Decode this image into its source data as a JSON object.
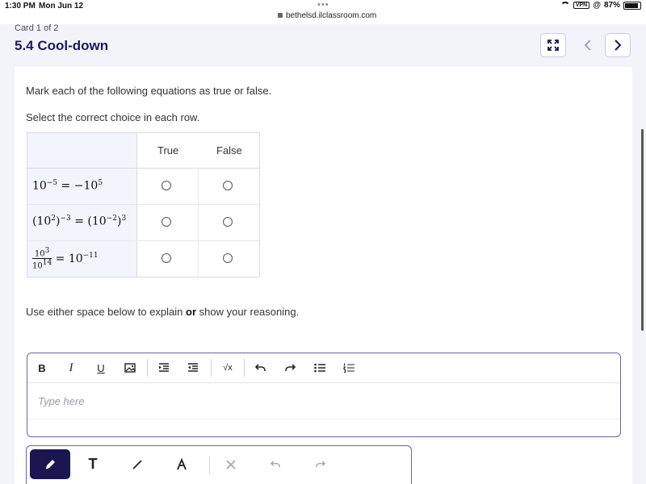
{
  "status_bar": {
    "time": "1:30 PM",
    "date": "Mon Jun 12",
    "url": "bethelsd.ilclassroom.com",
    "vpn": "VPN",
    "battery": "87%"
  },
  "header": {
    "card_counter": "Card 1 of 2",
    "title": "5.4 Cool-down",
    "expand_icon": "expand-icon",
    "prev_icon": "chevron-left-icon",
    "next_icon": "chevron-right-icon"
  },
  "question": {
    "instruction": "Mark each of the following equations as true or false.",
    "select_prompt": "Select the correct choice in each row.",
    "columns": [
      "True",
      "False"
    ],
    "rows": [
      {
        "equation": "10^-5 = -10^5",
        "true_selected": false,
        "false_selected": false
      },
      {
        "equation": "(10^2)^-3 = (10^-2)^3",
        "true_selected": false,
        "false_selected": false
      },
      {
        "equation": "10^3 / 10^14 = 10^-11",
        "true_selected": false,
        "false_selected": false
      }
    ]
  },
  "reasoning": {
    "prefix": "Use either space below to explain ",
    "bold": "or",
    "suffix": " show your reasoning."
  },
  "editor": {
    "placeholder": "Type here",
    "tools": [
      "bold-icon",
      "italic-icon",
      "underline-icon",
      "image-icon",
      "indent-icon",
      "outdent-icon",
      "math-icon",
      "undo-icon",
      "redo-icon",
      "bullet-list-icon",
      "numbered-list-icon"
    ],
    "bold_label": "B",
    "italic_label": "I",
    "underline_label": "U",
    "math_label": "√x"
  },
  "drawing_toolbar": {
    "tools": [
      "pencil-icon",
      "text-icon",
      "line-icon",
      "highlighter-icon",
      "clear-icon",
      "undo-icon",
      "redo-icon"
    ],
    "text_label": "T",
    "active_tool": "pencil-icon"
  },
  "colors": {
    "accent": "#1a1650",
    "border": "#6c64a8",
    "title": "#1b1b5a"
  }
}
